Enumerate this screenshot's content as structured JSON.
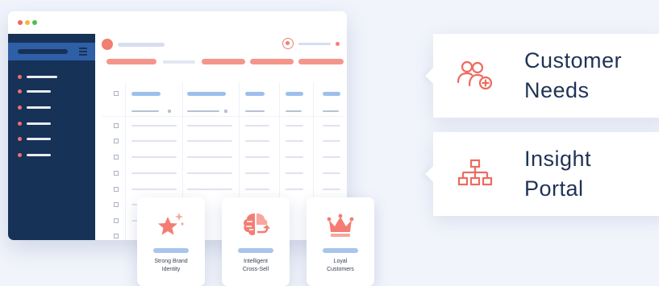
{
  "colors": {
    "accent": "#f27f6f",
    "sidebar": "#173257",
    "sidebar_highlight": "#2f5fa6",
    "header_bar": "#9dbfec",
    "title_text": "#1f3354"
  },
  "window": {
    "traffic_lights": [
      "#f2665e",
      "#f6b73c",
      "#48c153"
    ]
  },
  "features": [
    {
      "title": "Customer\nNeeds",
      "icon": "users-plus-icon"
    },
    {
      "title": "Insight\nPortal",
      "icon": "hierarchy-icon"
    }
  ],
  "cards": [
    {
      "label": "Strong Brand\nIdentity",
      "icon": "star-sparkle-icon"
    },
    {
      "label": "Intelligent\nCross-Sell",
      "icon": "brain-arrow-icon"
    },
    {
      "label": "Loyal\nCustomers",
      "icon": "crown-icon"
    }
  ]
}
